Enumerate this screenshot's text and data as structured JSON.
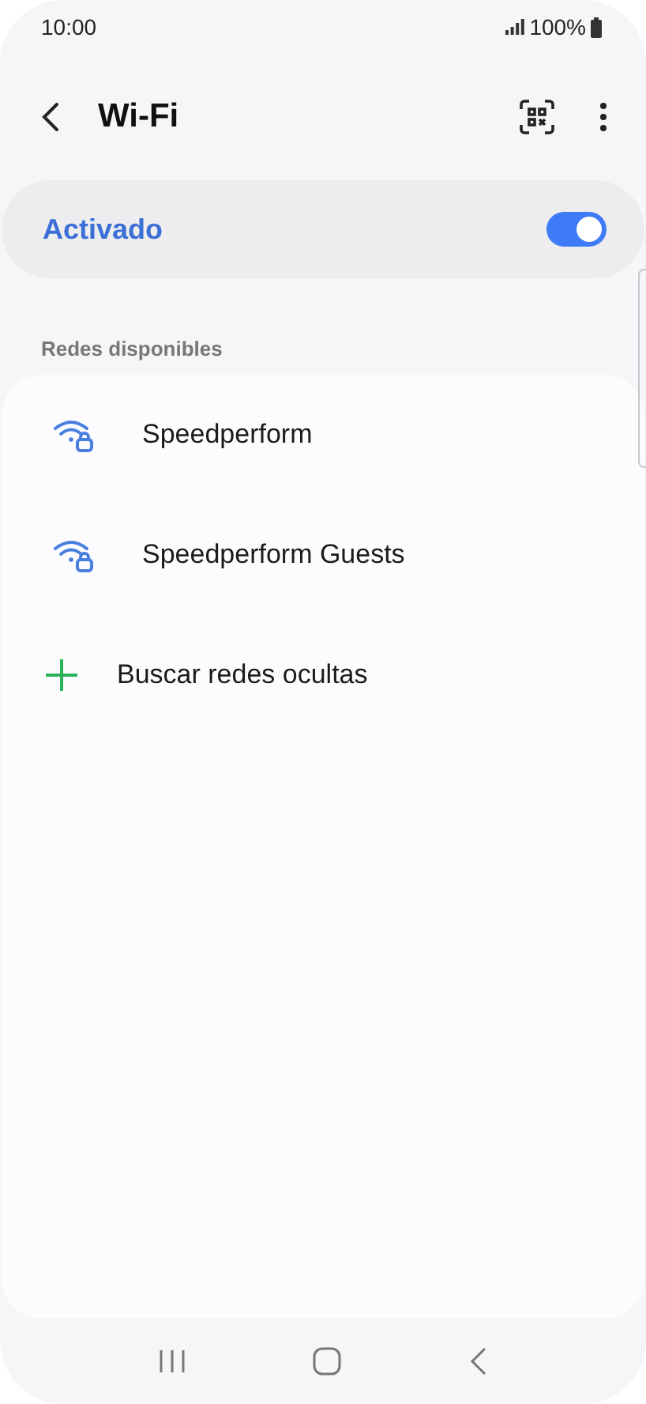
{
  "status_bar": {
    "time": "10:00",
    "battery": "100%"
  },
  "header": {
    "title": "Wi-Fi"
  },
  "wifi_toggle": {
    "label": "Activado",
    "on": true
  },
  "section_title": "Redes disponibles",
  "networks": [
    {
      "kind": "network",
      "name": "Speedperform"
    },
    {
      "kind": "network",
      "name": "Speedperform Guests"
    },
    {
      "kind": "action",
      "name": "Buscar redes ocultas"
    }
  ]
}
